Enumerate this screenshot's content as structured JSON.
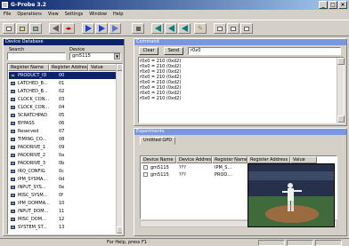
{
  "window": {
    "title": "G-Probe 3.2"
  },
  "menu": [
    "File",
    "Operations",
    "View",
    "Settings",
    "Window",
    "Help"
  ],
  "device_database": {
    "title": "Device Database",
    "search_label": "Search",
    "device_label": "Device",
    "device_value": "gm5115",
    "columns": [
      "Register Name",
      "Register Address",
      "Value"
    ],
    "rows": [
      {
        "name": "PRODUCT_ID",
        "addr": "00"
      },
      {
        "name": "LATCHED_B...",
        "addr": "01"
      },
      {
        "name": "LATCHED_B...",
        "addr": "02"
      },
      {
        "name": "CLOCK_CON...",
        "addr": "03"
      },
      {
        "name": "CLOCK_CON...",
        "addr": "04"
      },
      {
        "name": "SCRATCHPAD",
        "addr": "05"
      },
      {
        "name": "BYPASS",
        "addr": "06"
      },
      {
        "name": "Reserved",
        "addr": "07"
      },
      {
        "name": "TIMING_CO...",
        "addr": "08"
      },
      {
        "name": "PADDRIVE_1",
        "addr": "09"
      },
      {
        "name": "PADDRIVE_2",
        "addr": "0a"
      },
      {
        "name": "PADDRIVE_3",
        "addr": "0b"
      },
      {
        "name": "IRQ_CONFIG",
        "addr": "0c"
      },
      {
        "name": "IPM_SYSMA...",
        "addr": "0d"
      },
      {
        "name": "INPUT_SYS...",
        "addr": "0e"
      },
      {
        "name": "MISC_SYSM...",
        "addr": "0f"
      },
      {
        "name": "IPM_DOMMA...",
        "addr": "10"
      },
      {
        "name": "INPUT_DOM...",
        "addr": "11"
      },
      {
        "name": "MISC_DOM...",
        "addr": "12"
      },
      {
        "name": "SYSTEM_ST...",
        "addr": "13"
      }
    ]
  },
  "command_window": {
    "title": "Command",
    "clear_label": "Clear",
    "send_label": "Send",
    "input_value": "r0x0",
    "log_lines": [
      "r0x0 = 210 (0xd2)",
      "r0x0 = 210 (0xd2)",
      "r0x0 = 210 (0xd2)",
      "r0x0 = 210 (0xd2)",
      "r0x0 = 210 (0xd2)",
      "r0x0 = 210 (0xd2)",
      "r0x0 = 210 (0xd2)",
      "r0x0 = 210 (0xd2)"
    ]
  },
  "experiments": {
    "title": "Experiments",
    "tab": "Untitled GPD",
    "columns": [
      "Device Name",
      "Device Address",
      "Register Name",
      "Register Address",
      "Value"
    ],
    "rows": [
      {
        "device": "gm5115",
        "addr": "???",
        "reg": "IPM_S..."
      },
      {
        "device": "gm5115",
        "addr": "???",
        "reg": "PROD..."
      }
    ]
  },
  "status": {
    "text": "For Help, press F1"
  }
}
